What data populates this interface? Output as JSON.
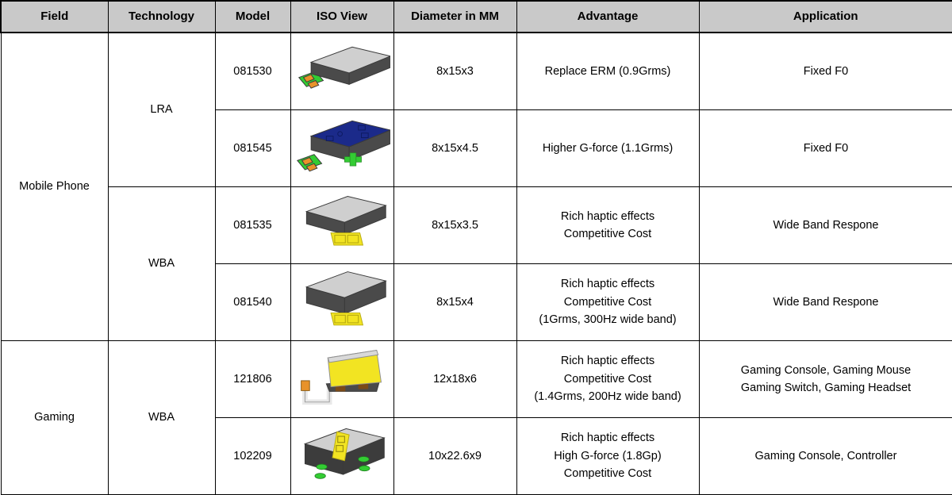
{
  "table": {
    "columns": [
      {
        "key": "field",
        "label": "Field"
      },
      {
        "key": "technology",
        "label": "Technology"
      },
      {
        "key": "model",
        "label": "Model"
      },
      {
        "key": "iso_view",
        "label": "ISO View"
      },
      {
        "key": "diameter",
        "label": "Diameter in MM"
      },
      {
        "key": "advantage",
        "label": "Advantage"
      },
      {
        "key": "application",
        "label": "Application"
      }
    ],
    "groups": [
      {
        "field": "Mobile Phone",
        "technologies": [
          {
            "technology": "LRA",
            "rows": [
              {
                "model": "081530",
                "iso_view": "lra-gray-module-orange-flex",
                "diameter": "8x15x3",
                "advantage_lines": [
                  "Replace ERM (0.9Grms)"
                ],
                "application_lines": [
                  "Fixed F0"
                ]
              },
              {
                "model": "081545",
                "iso_view": "lra-blue-top-module-green-pad",
                "diameter": "8x15x4.5",
                "advantage_lines": [
                  "Higher G-force (1.1Grms)"
                ],
                "application_lines": [
                  "Fixed F0"
                ]
              }
            ]
          },
          {
            "technology": "WBA",
            "rows": [
              {
                "model": "081535",
                "iso_view": "wba-gray-module-yellow-pad",
                "diameter": "8x15x3.5",
                "advantage_lines": [
                  "Rich haptic effects",
                  "Competitive Cost"
                ],
                "application_lines": [
                  "Wide Band Respone"
                ]
              },
              {
                "model": "081540",
                "iso_view": "wba-gray-module-yellow-pad-tall",
                "diameter": "8x15x4",
                "advantage_lines": [
                  "Rich haptic effects",
                  "Competitive Cost",
                  "(1Grms, 300Hz wide band)"
                ],
                "application_lines": [
                  "Wide Band Respone"
                ]
              }
            ]
          }
        ]
      },
      {
        "field": "Gaming",
        "technologies": [
          {
            "technology": "WBA",
            "rows": [
              {
                "model": "121806",
                "iso_view": "wba-yellow-module-flex-cable",
                "diameter": "12x18x6",
                "advantage_lines": [
                  "Rich haptic effects",
                  "Competitive Cost",
                  "(1.4Grms, 200Hz wide band)"
                ],
                "application_lines": [
                  "Gaming Console, Gaming Mouse",
                  "Gaming Switch, Gaming Headset"
                ]
              },
              {
                "model": "102209",
                "iso_view": "wba-dark-module-yellow-strip-green-pads",
                "diameter": "10x22.6x9",
                "advantage_lines": [
                  "Rich haptic effects",
                  "High G-force (1.8Gp)",
                  "Competitive Cost"
                ],
                "application_lines": [
                  "Gaming Console, Controller"
                ]
              }
            ]
          }
        ]
      }
    ]
  },
  "colors": {
    "header_background": "#c9c9c9",
    "border": "#000000",
    "module_gray_top": "#cfcfcf",
    "module_gray_side": "#4a4a4a",
    "module_blue_top": "#1b2a8a",
    "module_yellow": "#f2e422",
    "pad_green": "#33cc33",
    "pad_orange": "#e8922a",
    "flex_white": "#e8e8e8"
  }
}
